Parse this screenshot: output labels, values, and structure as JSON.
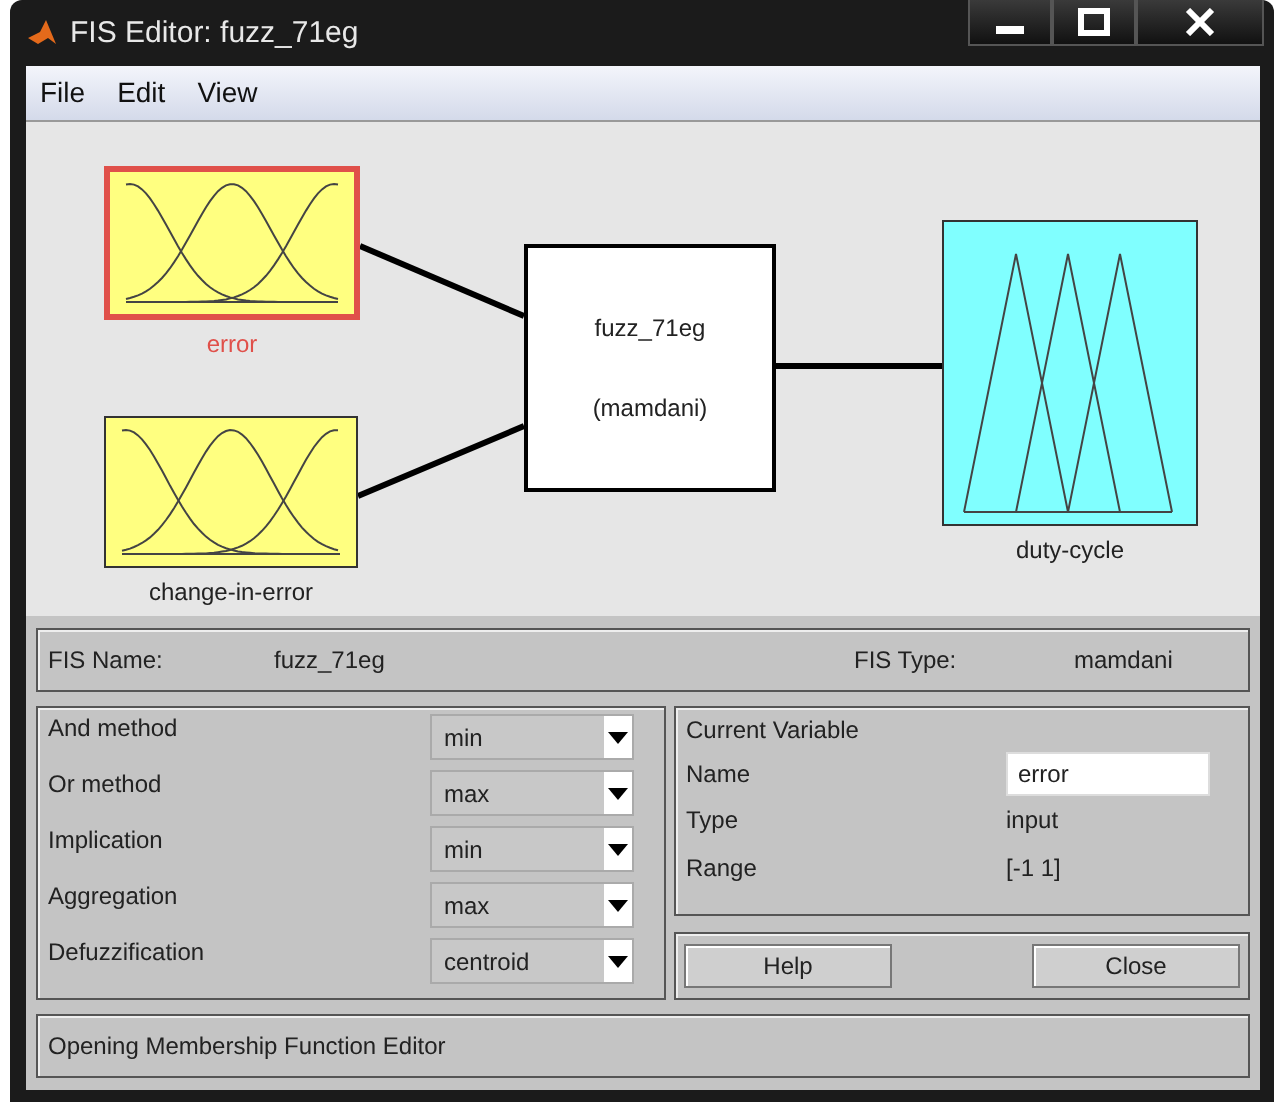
{
  "window": {
    "title": "FIS Editor: fuzz_71eg"
  },
  "menu": [
    "File",
    "Edit",
    "View"
  ],
  "diagram": {
    "inputs": [
      {
        "name": "error",
        "kind": "gauss",
        "selected": true
      },
      {
        "name": "change-in-error",
        "kind": "gauss",
        "selected": false
      }
    ],
    "system": {
      "name": "fuzz_71eg",
      "type": "(mamdani)"
    },
    "outputs": [
      {
        "name": "duty-cycle",
        "kind": "triangle",
        "selected": false
      }
    ]
  },
  "fis": {
    "name_label": "FIS Name:",
    "name": "fuzz_71eg",
    "type_label": "FIS Type:",
    "type": "mamdani"
  },
  "methods": [
    {
      "label": "And method",
      "value": "min"
    },
    {
      "label": "Or method",
      "value": "max"
    },
    {
      "label": "Implication",
      "value": "min"
    },
    {
      "label": "Aggregation",
      "value": "max"
    },
    {
      "label": "Defuzzification",
      "value": "centroid"
    }
  ],
  "current_variable": {
    "title": "Current Variable",
    "rows": [
      {
        "label": "Name",
        "value": "error",
        "kind": "field"
      },
      {
        "label": "Type",
        "value": "input",
        "kind": "text"
      },
      {
        "label": "Range",
        "value": "[-1 1]",
        "kind": "text"
      }
    ]
  },
  "buttons": [
    "Help",
    "Close"
  ],
  "status": "Opening Membership Function Editor"
}
